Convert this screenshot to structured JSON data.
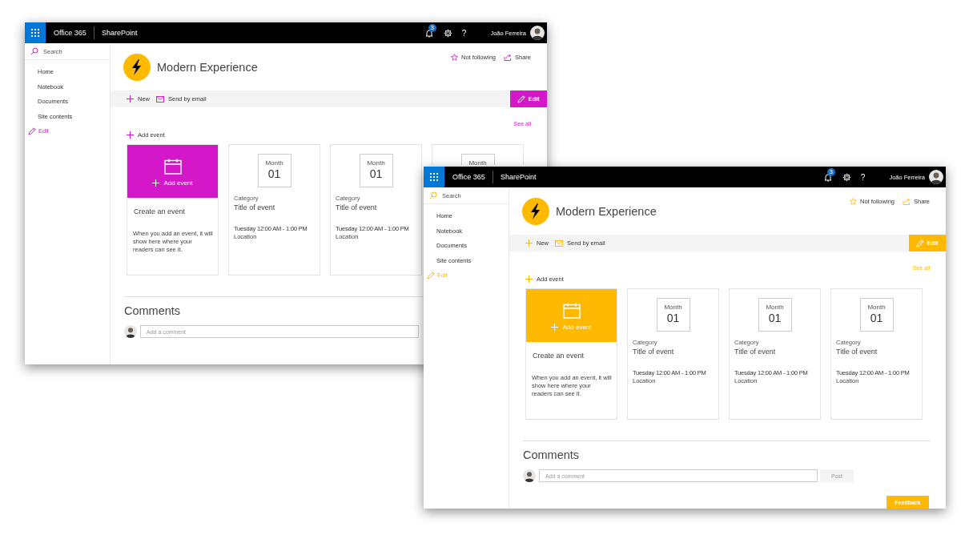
{
  "windows": [
    {
      "color": "#d417c8",
      "suite_title": "Office 365",
      "app_title": "SharePoint",
      "notifications": "3",
      "help": "?",
      "user_name": "João Ferreira",
      "search": {
        "placeholder": "Search"
      },
      "nav": [
        "Home",
        "Notebook",
        "Documents",
        "Site contents"
      ],
      "nav_edit": "Edit",
      "site_title": "Modern Experience",
      "follow": "Not following",
      "share": "Share",
      "commands": [
        "New",
        "Send by email"
      ],
      "edit_button": "Edit",
      "see_all": "See all",
      "add_event": "Add event",
      "create_card": {
        "button": "Add event",
        "title": "Create an event",
        "description": "When you add an event, it will show here where your readers can see it."
      },
      "events": [
        {
          "month": "Month",
          "day": "01",
          "category": "Category",
          "title": "Title of event",
          "time": "Tuesday 12:00 AM - 1:00 PM",
          "location": "Location"
        },
        {
          "month": "Month",
          "day": "01",
          "category": "Category",
          "title": "Title of event",
          "time": "Tuesday 12:00 AM - 1:00 PM",
          "location": "Location"
        },
        {
          "month": "Month"
        }
      ],
      "comments": {
        "title": "Comments",
        "placeholder": "Add a comment"
      }
    },
    {
      "color": "#ffb900",
      "suite_title": "Office 365",
      "app_title": "SharePoint",
      "notifications": "3",
      "help": "?",
      "user_name": "João Ferreira",
      "search": {
        "placeholder": "Search"
      },
      "nav": [
        "Home",
        "Notebook",
        "Documents",
        "Site contents"
      ],
      "nav_edit": "Edit",
      "site_title": "Modern Experience",
      "follow": "Not following",
      "share": "Share",
      "commands": [
        "New",
        "Send by email"
      ],
      "edit_button": "Edit",
      "see_all": "See all",
      "add_event": "Add event",
      "create_card": {
        "button": "Add event",
        "title": "Create an event",
        "description": "When you add an event, it will show here where your readers can see it."
      },
      "events": [
        {
          "month": "Month",
          "day": "01",
          "category": "Category",
          "title": "Title of event",
          "time": "Tuesday 12:00 AM - 1:00 PM",
          "location": "Location"
        },
        {
          "month": "Month",
          "day": "01",
          "category": "Category",
          "title": "Title of event",
          "time": "Tuesday 12:00 AM - 1:00 PM",
          "location": "Location"
        },
        {
          "month": "Month",
          "day": "01",
          "category": "Category",
          "title": "Title of event",
          "time": "Tuesday 12:00 AM - 1:00 PM",
          "location": "Location"
        }
      ],
      "comments": {
        "title": "Comments",
        "placeholder": "Add a comment",
        "post": "Post"
      },
      "feedback": "Feedback"
    }
  ]
}
